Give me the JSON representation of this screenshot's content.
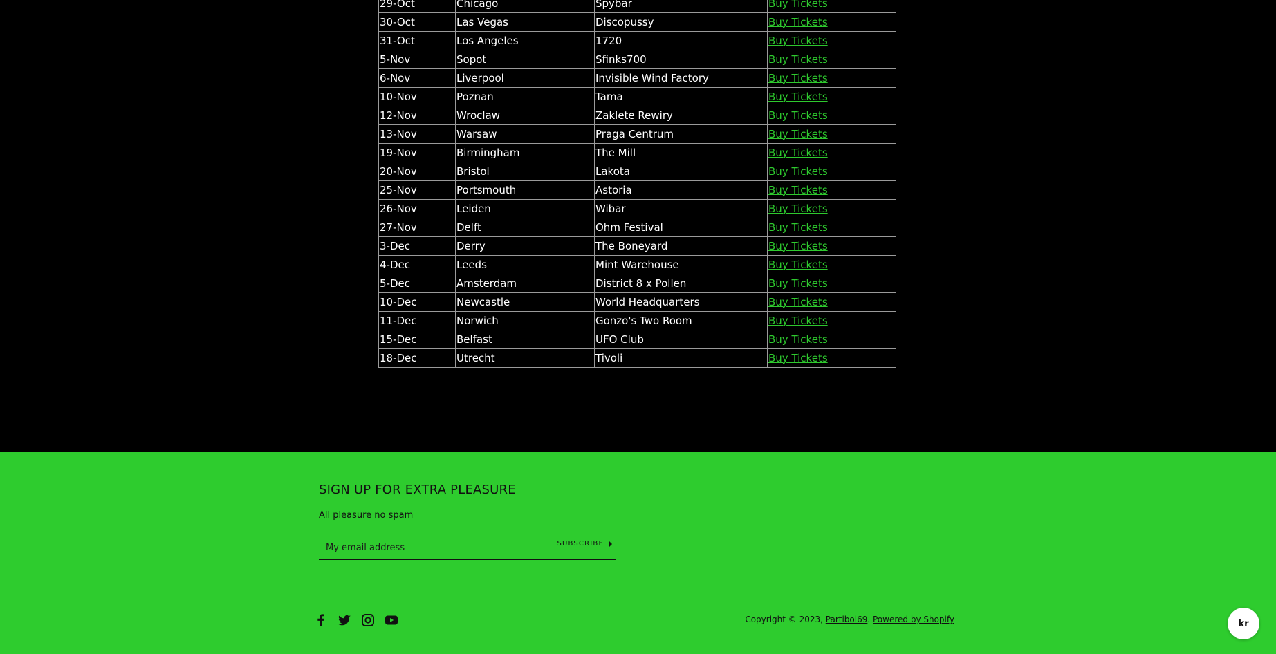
{
  "tour": {
    "rows": [
      {
        "date": "29-Oct",
        "city": "Chicago",
        "venue": "Spybar",
        "link": "Buy Tickets"
      },
      {
        "date": "30-Oct",
        "city": "Las Vegas",
        "venue": "Discopussy",
        "link": "Buy Tickets"
      },
      {
        "date": "31-Oct",
        "city": "Los Angeles",
        "venue": "1720",
        "link": "Buy Tickets"
      },
      {
        "date": "5-Nov",
        "city": "Sopot",
        "venue": "Sfinks700",
        "link": "Buy Tickets"
      },
      {
        "date": "6-Nov",
        "city": "Liverpool",
        "venue": "Invisible Wind Factory",
        "link": "Buy Tickets"
      },
      {
        "date": "10-Nov",
        "city": "Poznan",
        "venue": "Tama",
        "link": "Buy Tickets"
      },
      {
        "date": "12-Nov",
        "city": "Wroclaw",
        "venue": "Zaklete Rewiry",
        "link": "Buy Tickets"
      },
      {
        "date": "13-Nov",
        "city": "Warsaw",
        "venue": "Praga Centrum",
        "link": "Buy Tickets"
      },
      {
        "date": "19-Nov",
        "city": "Birmingham",
        "venue": "The Mill",
        "link": "Buy Tickets"
      },
      {
        "date": "20-Nov",
        "city": "Bristol",
        "venue": "Lakota",
        "link": "Buy Tickets"
      },
      {
        "date": "25-Nov",
        "city": "Portsmouth",
        "venue": "Astoria",
        "link": "Buy Tickets"
      },
      {
        "date": "26-Nov",
        "city": "Leiden",
        "venue": "Wibar",
        "link": "Buy Tickets"
      },
      {
        "date": "27-Nov",
        "city": "Delft",
        "venue": "Ohm Festival",
        "link": "Buy Tickets"
      },
      {
        "date": "3-Dec",
        "city": "Derry",
        "venue": "The Boneyard",
        "link": "Buy Tickets"
      },
      {
        "date": "4-Dec",
        "city": "Leeds",
        "venue": "Mint Warehouse",
        "link": "Buy Tickets"
      },
      {
        "date": "5-Dec",
        "city": "Amsterdam",
        "venue": "District 8 x Pollen",
        "link": "Buy Tickets"
      },
      {
        "date": "10-Dec",
        "city": "Newcastle",
        "venue": "World Headquarters",
        "link": "Buy Tickets"
      },
      {
        "date": "11-Dec",
        "city": "Norwich",
        "venue": "Gonzo's Two Room",
        "link": "Buy Tickets"
      },
      {
        "date": "15-Dec",
        "city": "Belfast",
        "venue": "UFO Club",
        "link": "Buy Tickets"
      },
      {
        "date": "18-Dec",
        "city": "Utrecht",
        "venue": "Tivoli",
        "link": "Buy Tickets"
      }
    ]
  },
  "footer": {
    "signup_title": "SIGN UP FOR EXTRA PLEASURE",
    "signup_sub": "All pleasure no spam",
    "email_placeholder": "My email address",
    "subscribe_label": "SUBSCRIBE",
    "social_icons": [
      "facebook-icon",
      "twitter-icon",
      "instagram-icon",
      "youtube-icon"
    ],
    "copyright_prefix": "Copyright © 2023, ",
    "store_name": "Partiboi69",
    "separator": ". ",
    "powered_by": "Powered by Shopify",
    "locale_label": "kr"
  },
  "colors": {
    "page_background": "#000000",
    "footer_background": "#2ecc2e",
    "link_green": "#2ec92e"
  }
}
